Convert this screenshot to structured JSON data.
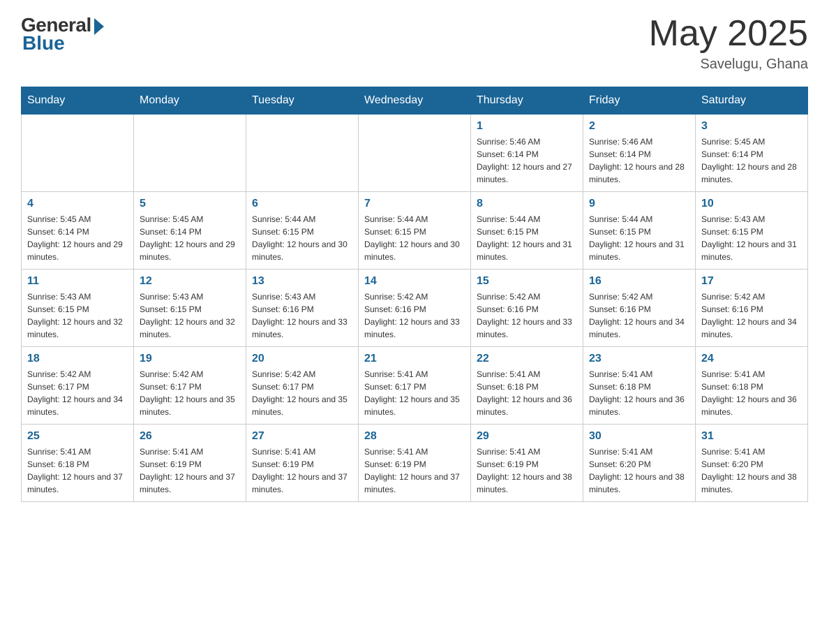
{
  "header": {
    "logo_general": "General",
    "logo_blue": "Blue",
    "month_title": "May 2025",
    "location": "Savelugu, Ghana"
  },
  "days_of_week": [
    "Sunday",
    "Monday",
    "Tuesday",
    "Wednesday",
    "Thursday",
    "Friday",
    "Saturday"
  ],
  "weeks": [
    [
      {
        "day": "",
        "info": ""
      },
      {
        "day": "",
        "info": ""
      },
      {
        "day": "",
        "info": ""
      },
      {
        "day": "",
        "info": ""
      },
      {
        "day": "1",
        "info": "Sunrise: 5:46 AM\nSunset: 6:14 PM\nDaylight: 12 hours and 27 minutes."
      },
      {
        "day": "2",
        "info": "Sunrise: 5:46 AM\nSunset: 6:14 PM\nDaylight: 12 hours and 28 minutes."
      },
      {
        "day": "3",
        "info": "Sunrise: 5:45 AM\nSunset: 6:14 PM\nDaylight: 12 hours and 28 minutes."
      }
    ],
    [
      {
        "day": "4",
        "info": "Sunrise: 5:45 AM\nSunset: 6:14 PM\nDaylight: 12 hours and 29 minutes."
      },
      {
        "day": "5",
        "info": "Sunrise: 5:45 AM\nSunset: 6:14 PM\nDaylight: 12 hours and 29 minutes."
      },
      {
        "day": "6",
        "info": "Sunrise: 5:44 AM\nSunset: 6:15 PM\nDaylight: 12 hours and 30 minutes."
      },
      {
        "day": "7",
        "info": "Sunrise: 5:44 AM\nSunset: 6:15 PM\nDaylight: 12 hours and 30 minutes."
      },
      {
        "day": "8",
        "info": "Sunrise: 5:44 AM\nSunset: 6:15 PM\nDaylight: 12 hours and 31 minutes."
      },
      {
        "day": "9",
        "info": "Sunrise: 5:44 AM\nSunset: 6:15 PM\nDaylight: 12 hours and 31 minutes."
      },
      {
        "day": "10",
        "info": "Sunrise: 5:43 AM\nSunset: 6:15 PM\nDaylight: 12 hours and 31 minutes."
      }
    ],
    [
      {
        "day": "11",
        "info": "Sunrise: 5:43 AM\nSunset: 6:15 PM\nDaylight: 12 hours and 32 minutes."
      },
      {
        "day": "12",
        "info": "Sunrise: 5:43 AM\nSunset: 6:15 PM\nDaylight: 12 hours and 32 minutes."
      },
      {
        "day": "13",
        "info": "Sunrise: 5:43 AM\nSunset: 6:16 PM\nDaylight: 12 hours and 33 minutes."
      },
      {
        "day": "14",
        "info": "Sunrise: 5:42 AM\nSunset: 6:16 PM\nDaylight: 12 hours and 33 minutes."
      },
      {
        "day": "15",
        "info": "Sunrise: 5:42 AM\nSunset: 6:16 PM\nDaylight: 12 hours and 33 minutes."
      },
      {
        "day": "16",
        "info": "Sunrise: 5:42 AM\nSunset: 6:16 PM\nDaylight: 12 hours and 34 minutes."
      },
      {
        "day": "17",
        "info": "Sunrise: 5:42 AM\nSunset: 6:16 PM\nDaylight: 12 hours and 34 minutes."
      }
    ],
    [
      {
        "day": "18",
        "info": "Sunrise: 5:42 AM\nSunset: 6:17 PM\nDaylight: 12 hours and 34 minutes."
      },
      {
        "day": "19",
        "info": "Sunrise: 5:42 AM\nSunset: 6:17 PM\nDaylight: 12 hours and 35 minutes."
      },
      {
        "day": "20",
        "info": "Sunrise: 5:42 AM\nSunset: 6:17 PM\nDaylight: 12 hours and 35 minutes."
      },
      {
        "day": "21",
        "info": "Sunrise: 5:41 AM\nSunset: 6:17 PM\nDaylight: 12 hours and 35 minutes."
      },
      {
        "day": "22",
        "info": "Sunrise: 5:41 AM\nSunset: 6:18 PM\nDaylight: 12 hours and 36 minutes."
      },
      {
        "day": "23",
        "info": "Sunrise: 5:41 AM\nSunset: 6:18 PM\nDaylight: 12 hours and 36 minutes."
      },
      {
        "day": "24",
        "info": "Sunrise: 5:41 AM\nSunset: 6:18 PM\nDaylight: 12 hours and 36 minutes."
      }
    ],
    [
      {
        "day": "25",
        "info": "Sunrise: 5:41 AM\nSunset: 6:18 PM\nDaylight: 12 hours and 37 minutes."
      },
      {
        "day": "26",
        "info": "Sunrise: 5:41 AM\nSunset: 6:19 PM\nDaylight: 12 hours and 37 minutes."
      },
      {
        "day": "27",
        "info": "Sunrise: 5:41 AM\nSunset: 6:19 PM\nDaylight: 12 hours and 37 minutes."
      },
      {
        "day": "28",
        "info": "Sunrise: 5:41 AM\nSunset: 6:19 PM\nDaylight: 12 hours and 37 minutes."
      },
      {
        "day": "29",
        "info": "Sunrise: 5:41 AM\nSunset: 6:19 PM\nDaylight: 12 hours and 38 minutes."
      },
      {
        "day": "30",
        "info": "Sunrise: 5:41 AM\nSunset: 6:20 PM\nDaylight: 12 hours and 38 minutes."
      },
      {
        "day": "31",
        "info": "Sunrise: 5:41 AM\nSunset: 6:20 PM\nDaylight: 12 hours and 38 minutes."
      }
    ]
  ]
}
